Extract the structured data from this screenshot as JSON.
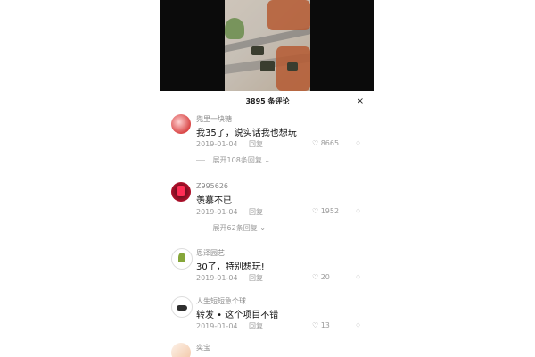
{
  "sheet": {
    "title": "3895 条评论",
    "close_icon": "×"
  },
  "comments": [
    {
      "username": "兜里一块糖",
      "text": "我35了，说实话我也想玩",
      "date": "2019-01-04",
      "reply": "回复",
      "likes": "8665",
      "expand": "展开108条回复"
    },
    {
      "username": "Z995626",
      "text": "羡慕不已",
      "date": "2019-01-04",
      "reply": "回复",
      "likes": "1952",
      "expand": "展开62条回复"
    },
    {
      "username": "恩泽园艺",
      "text": "30了，特别想玩!",
      "date": "2019-01-04",
      "reply": "回复",
      "likes": "20"
    },
    {
      "username": "人生短短急个球",
      "text": "转发 • 这个项目不错",
      "date": "2019-01-04",
      "reply": "回复",
      "likes": "13"
    },
    {
      "username": "奕宝"
    }
  ],
  "icons": {
    "heart": "♡",
    "dislike": "♢",
    "chevron": "⌄"
  }
}
